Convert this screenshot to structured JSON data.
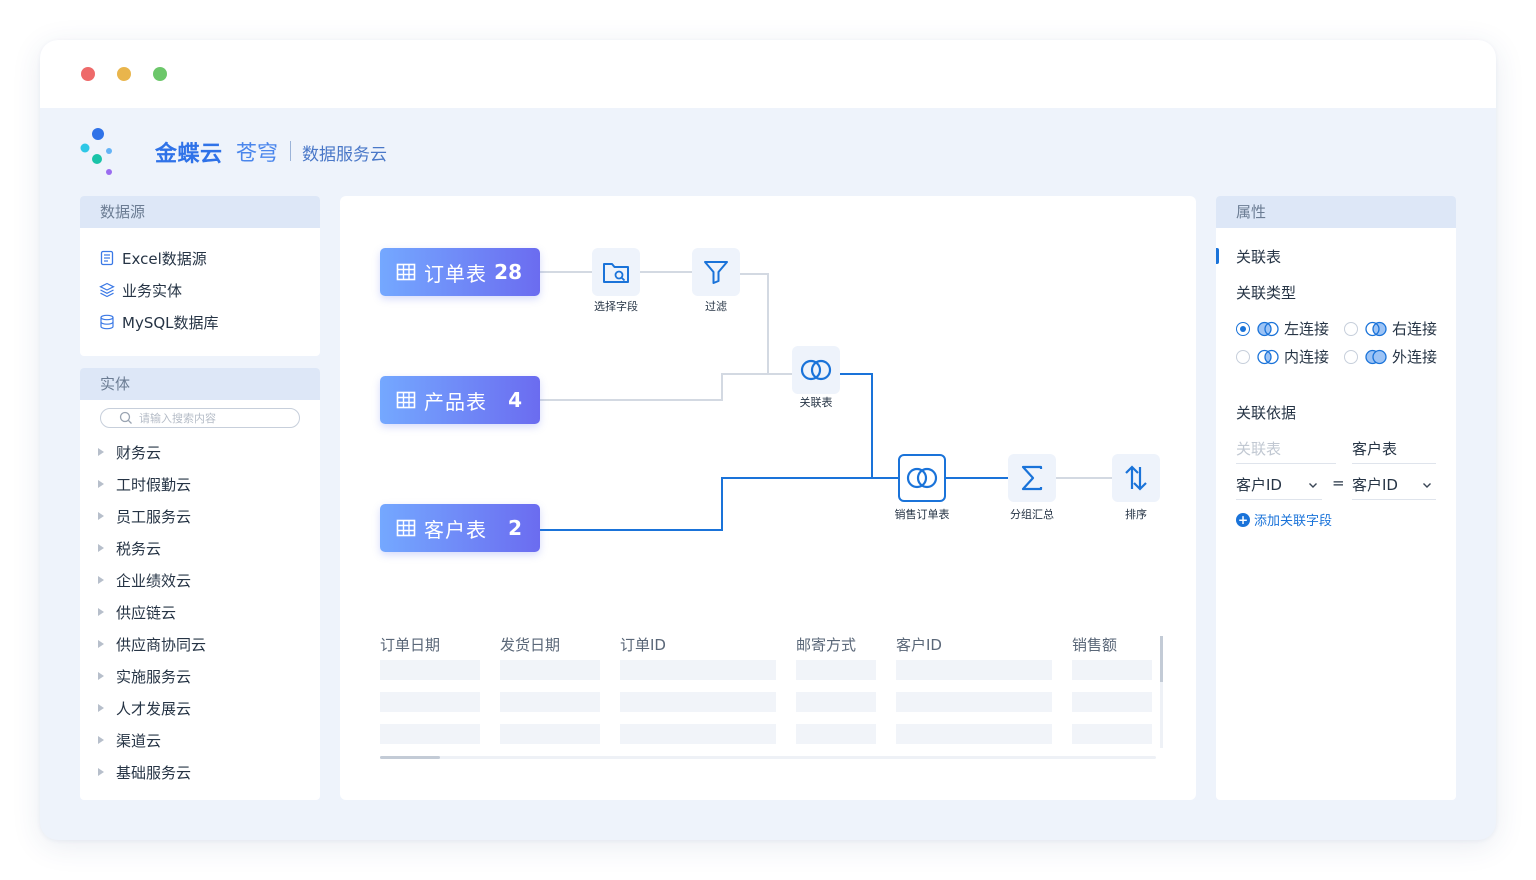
{
  "brand": {
    "name_primary": "金蝶云",
    "name_secondary": "苍穹",
    "product": "数据服务云",
    "colors": {
      "primary": "#2f72e8",
      "accent": "#1a73d9"
    }
  },
  "datasource": {
    "title": "数据源",
    "items": [
      {
        "label": "Excel数据源",
        "icon": "excel-file-icon"
      },
      {
        "label": "业务实体",
        "icon": "layers-icon"
      },
      {
        "label": "MySQL数据库",
        "icon": "database-icon"
      }
    ]
  },
  "entity": {
    "title": "实体",
    "search_placeholder": "请输入搜索内容",
    "items": [
      "财务云",
      "工时假勤云",
      "员工服务云",
      "税务云",
      "企业绩效云",
      "供应链云",
      "供应商协同云",
      "实施服务云",
      "人才发展云",
      "渠道云",
      "基础服务云"
    ]
  },
  "canvas": {
    "tables": [
      {
        "name": "订单表",
        "count": "28"
      },
      {
        "name": "产品表",
        "count": "4"
      },
      {
        "name": "客户表",
        "count": "2"
      }
    ],
    "ops": {
      "select_fields": "选择字段",
      "filter": "过滤",
      "join": "关联表",
      "sales_orders": "销售订单表",
      "group_sum": "分组汇总",
      "sort": "排序"
    },
    "grid_columns": [
      "订单日期",
      "发货日期",
      "订单ID",
      "邮寄方式",
      "客户ID",
      "销售额"
    ],
    "grid_rows": 3
  },
  "properties": {
    "title": "属性",
    "section_join_table": "关联表",
    "section_join_type": "关联类型",
    "join_types": [
      {
        "label": "左连接",
        "selected": true
      },
      {
        "label": "右连接",
        "selected": false
      },
      {
        "label": "内连接",
        "selected": false
      },
      {
        "label": "外连接",
        "selected": false
      }
    ],
    "section_basis": "关联依据",
    "col_left_header": "关联表",
    "col_right_header": "客户表",
    "left_field": "客户ID",
    "equals": "=",
    "right_field": "客户ID",
    "add_field": "添加关联字段"
  }
}
